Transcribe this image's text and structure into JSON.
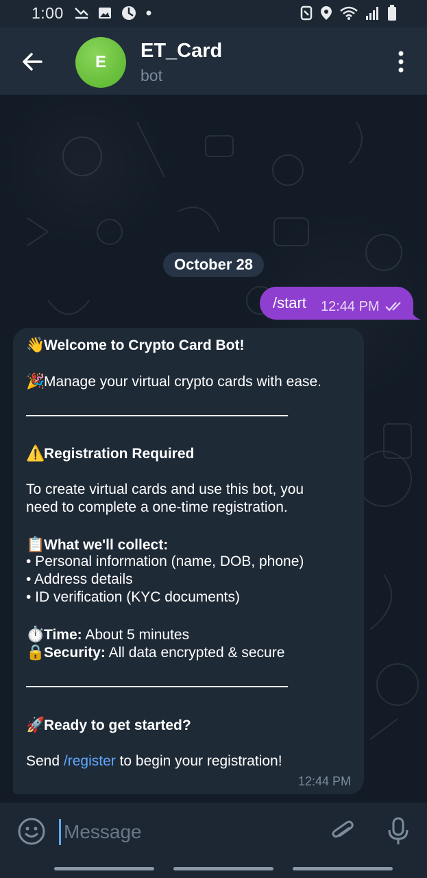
{
  "status_bar": {
    "time": "1:00",
    "left_icons": [
      "missed-call-icon",
      "image-icon",
      "browser-icon",
      "dot-icon"
    ],
    "right_icons": [
      "nfc-icon",
      "location-icon",
      "wifi-icon",
      "signal-icon",
      "battery-icon"
    ]
  },
  "header": {
    "avatar_letter": "E",
    "avatar_color": "#5cb82f",
    "title": "ET_Card",
    "subtitle": "bot"
  },
  "chat": {
    "date": "October 28",
    "outgoing": {
      "text": "/start",
      "time": "12:44 PM",
      "bubble_color": "#8e3fcf"
    },
    "incoming": {
      "greeting_emoji": "👋",
      "greeting": "Welcome to Crypto Card Bot!",
      "intro_emoji": "🎉",
      "intro": "Manage your virtual crypto cards with ease.",
      "warning_emoji": "⚠️",
      "registration_heading": "Registration Required",
      "body_line1": "To create virtual cards and use this bot, you",
      "body_line2": "need to complete a one-time registration.",
      "collect_emoji": "📋",
      "collect_heading": "What we'll collect:",
      "collect_items": [
        "• Personal information (name, DOB, phone)",
        "• Address details",
        "• ID verification (KYC documents)"
      ],
      "time_emoji": "⏱️",
      "time_label": "Time:",
      "time_value": "About 5 minutes",
      "security_emoji": "🔒",
      "security_label": "Security:",
      "security_value": "All data encrypted & secure",
      "ready_emoji": "🚀",
      "ready_heading": "Ready to get started?",
      "send_prefix": "Send ",
      "send_command": "/register",
      "send_suffix": " to begin your registration!",
      "time": "12:44 PM"
    }
  },
  "composer": {
    "placeholder": "Message"
  },
  "colors": {
    "accent_link": "#5fa8ff",
    "header_bg": "#212d3b",
    "incoming_bubble": "#1f2a37"
  }
}
